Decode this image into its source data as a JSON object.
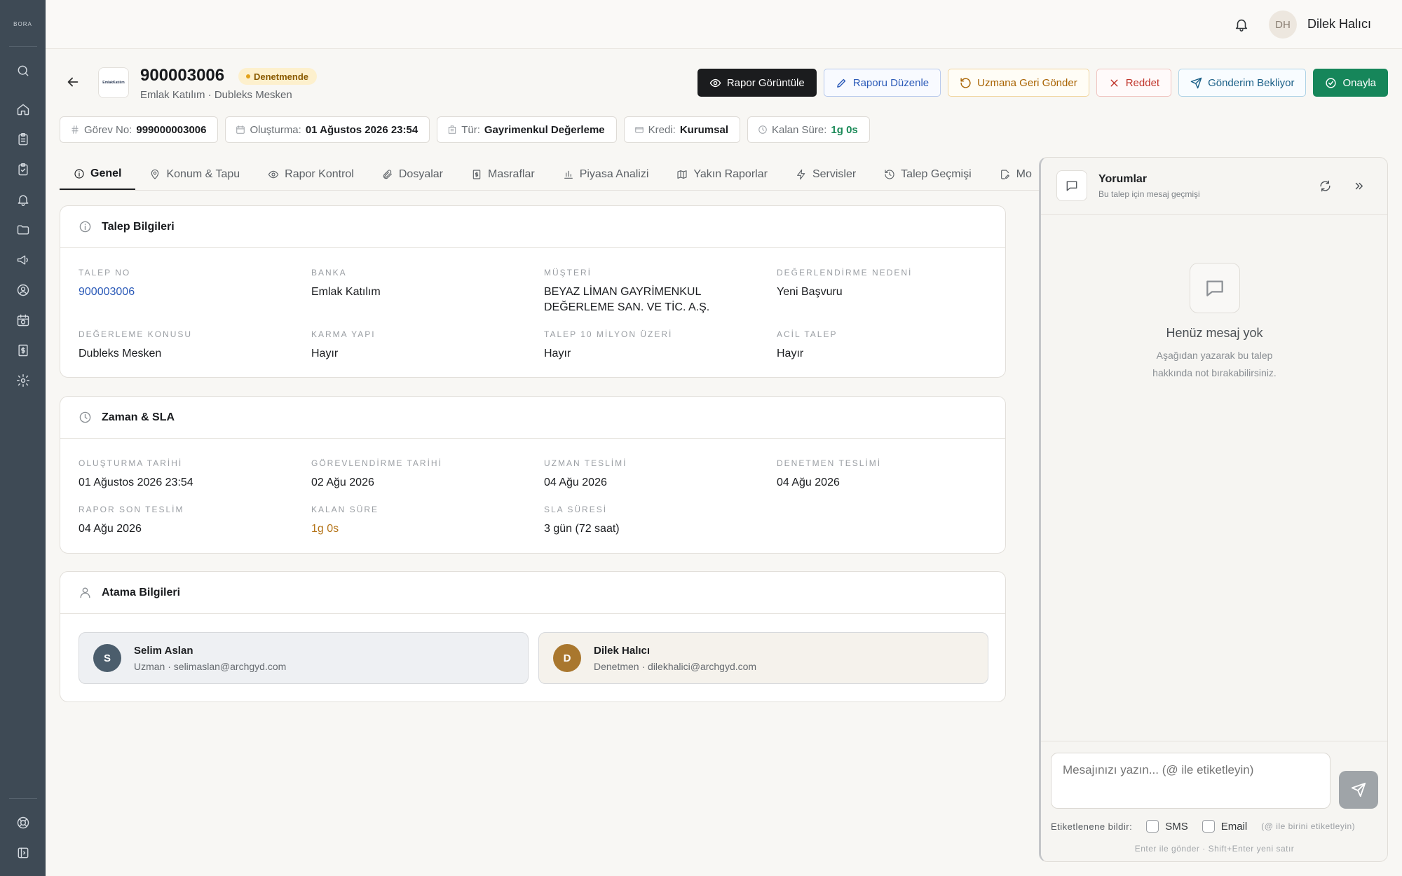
{
  "sidebar": {
    "logo": "BORA",
    "items": [
      "search-icon",
      "home-icon",
      "clipboard-icon",
      "clipboard-check-icon",
      "bell-icon",
      "folder-icon",
      "megaphone-icon",
      "user-circle-icon",
      "calendar-clock-icon",
      "receipt-icon",
      "gear-icon"
    ],
    "bottom": [
      "help-icon",
      "sidebar-toggle-icon"
    ]
  },
  "topbar": {
    "avatar_initials": "DH",
    "user_name": "Dilek Halıcı"
  },
  "header": {
    "bank_logo_text": "EmlakKatılım",
    "request_id": "900003006",
    "status": "Denetmende",
    "subtitle": "Emlak Katılım · Dubleks Mesken"
  },
  "actions": {
    "view": "Rapor Görüntüle",
    "edit": "Raporu Düzenle",
    "return": "Uzmana Geri Gönder",
    "reject": "Reddet",
    "pending": "Gönderim Bekliyor",
    "approve": "Onayla"
  },
  "chips": {
    "task_label": "Görev No:",
    "task_value": "999000003006",
    "created_label": "Oluşturma:",
    "created_value": "01 Ağustos 2026 23:54",
    "type_label": "Tür:",
    "type_value": "Gayrimenkul Değerleme",
    "credit_label": "Kredi:",
    "credit_value": "Kurumsal",
    "remaining_label": "Kalan Süre:",
    "remaining_value": "1g 0s"
  },
  "tabs": [
    "Genel",
    "Konum & Tapu",
    "Rapor Kontrol",
    "Dosyalar",
    "Masraflar",
    "Piyasa Analizi",
    "Yakın Raporlar",
    "Servisler",
    "Talep Geçmişi",
    "Mo"
  ],
  "talep": {
    "title": "Talep Bilgileri",
    "talep_no_label": "TALEP NO",
    "talep_no": "900003006",
    "banka_label": "BANKA",
    "banka": "Emlak Katılım",
    "musteri_label": "MÜŞTERİ",
    "musteri": "BEYAZ LİMAN GAYRİMENKUL DEĞERLEME SAN. VE TİC. A.Ş.",
    "neden_label": "DEĞERLENDİRME NEDENİ",
    "neden": "Yeni Başvuru",
    "konu_label": "DEĞERLEME KONUSU",
    "konu": "Dubleks Mesken",
    "karma_label": "KARMA YAPI",
    "karma": "Hayır",
    "milyon_label": "TALEP 10 MİLYON ÜZERİ",
    "milyon": "Hayır",
    "acil_label": "ACİL TALEP",
    "acil": "Hayır"
  },
  "zaman": {
    "title": "Zaman & SLA",
    "olusturma_label": "OLUŞTURMA TARİHİ",
    "olusturma": "01 Ağustos 2026 23:54",
    "gorev_label": "GÖREVLENDİRME TARİHİ",
    "gorev": "02 Ağu 2026",
    "uzman_label": "UZMAN TESLİMİ",
    "uzman": "04 Ağu 2026",
    "denetmen_label": "DENETMEN TESLİMİ",
    "denetmen": "04 Ağu 2026",
    "rapor_label": "RAPOR SON TESLİM",
    "rapor": "04 Ağu 2026",
    "kalan_label": "KALAN SÜRE",
    "kalan": "1g 0s",
    "sla_label": "SLA SÜRESİ",
    "sla": "3 gün (72 saat)"
  },
  "atama": {
    "title": "Atama Bilgileri",
    "people": [
      {
        "initial": "S",
        "name": "Selim Aslan",
        "detail": "Uzman · selimaslan@archgyd.com",
        "color": "#4b5d6c",
        "bg": "#eef0f3"
      },
      {
        "initial": "D",
        "name": "Dilek Halıcı",
        "detail": "Denetmen · dilekhalici@archgyd.com",
        "color": "#a9772e",
        "bg": "#f5f2ec"
      }
    ]
  },
  "comments": {
    "title": "Yorumlar",
    "subtitle": "Bu talep için mesaj geçmişi",
    "empty_title": "Henüz mesaj yok",
    "empty_desc": "Aşağıdan yazarak bu talep hakkında not bırakabilirsiniz.",
    "placeholder": "Mesajınızı yazın... (@ ile etiketleyin)",
    "notify_label": "Etiketlenene bildir:",
    "sms": "SMS",
    "email": "Email",
    "notify_hint": "(@ ile birini etiketleyin)",
    "footer_hint": "Enter ile gönder · Shift+Enter yeni satır"
  }
}
